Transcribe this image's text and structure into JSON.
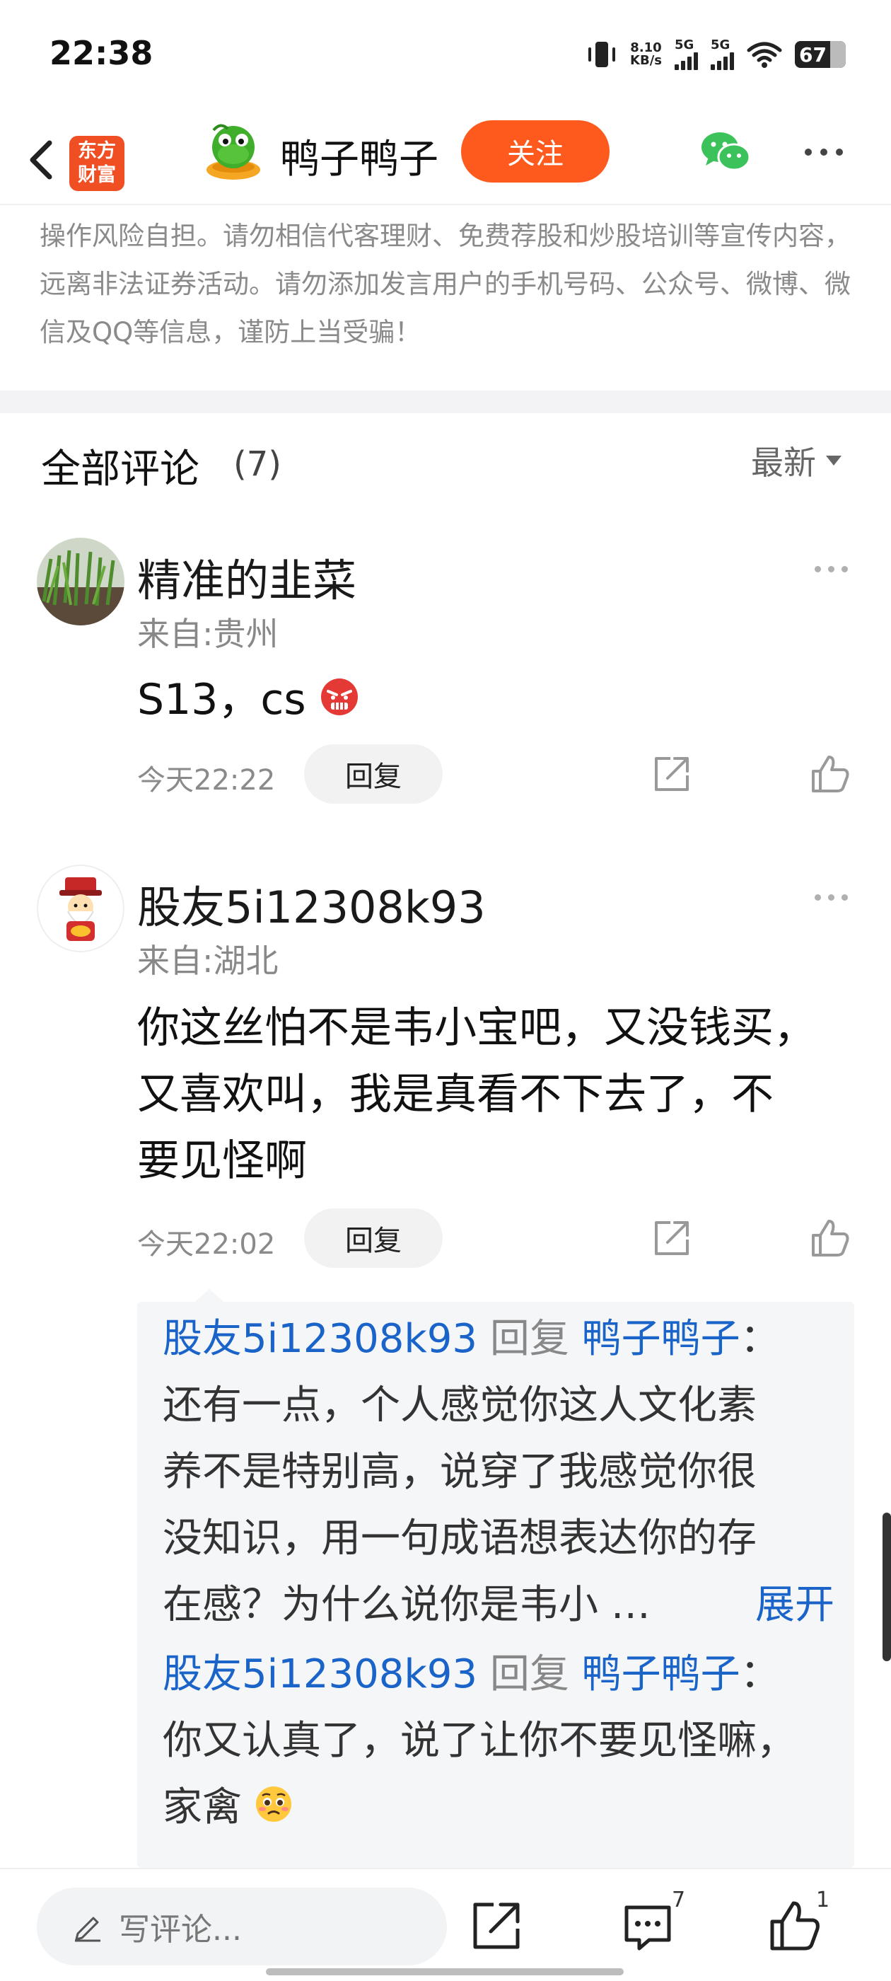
{
  "status_bar": {
    "time": "22:38",
    "net_speed_value": "8.10",
    "net_speed_unit": "KB/s",
    "sim1": "5G",
    "sim2": "5G",
    "battery": "67"
  },
  "header": {
    "logo_line1": "东方",
    "logo_line2": "财富",
    "name": "鸭子鸭子",
    "follow_label": "关注"
  },
  "disclaimer": "操作风险自担。请勿相信代客理财、免费荐股和炒股培训等宣传内容，远离非法证券活动。请勿添加发言用户的手机号码、公众号、微博、微信及QQ等信息，谨防上当受骗！",
  "comments_header": {
    "title": "全部评论",
    "count": "(7)",
    "sort": "最新"
  },
  "comments": [
    {
      "user": "精准的韭菜",
      "location": "来自:贵州",
      "text": "S13，cs",
      "time": "今天22:22",
      "reply_label": "回复"
    },
    {
      "user": "股友5i12308k93",
      "location": "来自:湖北",
      "text_lines": [
        "你这丝怕不是韦小宝吧，又没钱买，",
        "又喜欢叫，我是真看不下去了，不",
        "要见怪啊"
      ],
      "time": "今天22:02",
      "reply_label": "回复",
      "replies": [
        {
          "from": "股友5i12308k93",
          "verb": "回复",
          "to": "鸭子鸭子",
          "sep": "：",
          "lines": [
            "还有一点，个人感觉你这人文化素",
            "养不是特别高，说穿了我感觉你很",
            "没知识，用一句成语想表达你的存",
            "在感？为什么说你是韦小 …"
          ],
          "expand": "展开"
        },
        {
          "from": "股友5i12308k93",
          "verb": "回复",
          "to": "鸭子鸭子",
          "sep": "：",
          "lines": [
            "你又认真了，说了让你不要见怪嘛，",
            "家禽"
          ]
        }
      ]
    }
  ],
  "bottom_bar": {
    "placeholder": "写评论...",
    "comment_count": "7",
    "like_count": "1"
  },
  "colors": {
    "accent": "#ff5a1e",
    "link_blue": "#1a64c9",
    "muted": "#888888"
  }
}
